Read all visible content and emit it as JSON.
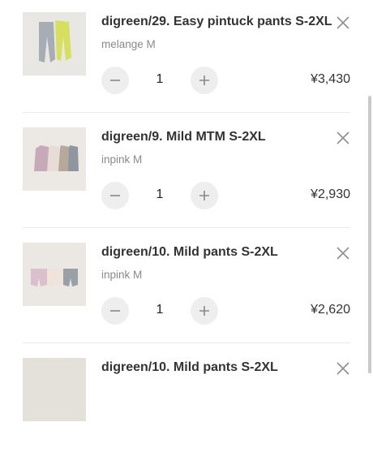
{
  "cart": {
    "items": [
      {
        "name": "digreen/29. Easy pintuck pants S-2XL",
        "option": "melange M",
        "quantity": "1",
        "price": "¥3,430",
        "thumbnail": "two-pants-photo"
      },
      {
        "name": "digreen/9. Mild MTM S-2XL",
        "option": "inpink M",
        "quantity": "1",
        "price": "¥2,930",
        "thumbnail": "sweatshirts-on-hangers-photo"
      },
      {
        "name": "digreen/10. Mild pants S-2XL",
        "option": "inpink M",
        "quantity": "1",
        "price": "¥2,620",
        "thumbnail": "shorts-on-hangers-photo"
      },
      {
        "name": "digreen/10. Mild pants S-2XL",
        "thumbnail": "shorts-on-hangers-photo"
      }
    ]
  },
  "colors": {
    "button_bg": "#eeeeee",
    "divider": "#e9e9e9",
    "option_text": "#8a8a8a"
  }
}
